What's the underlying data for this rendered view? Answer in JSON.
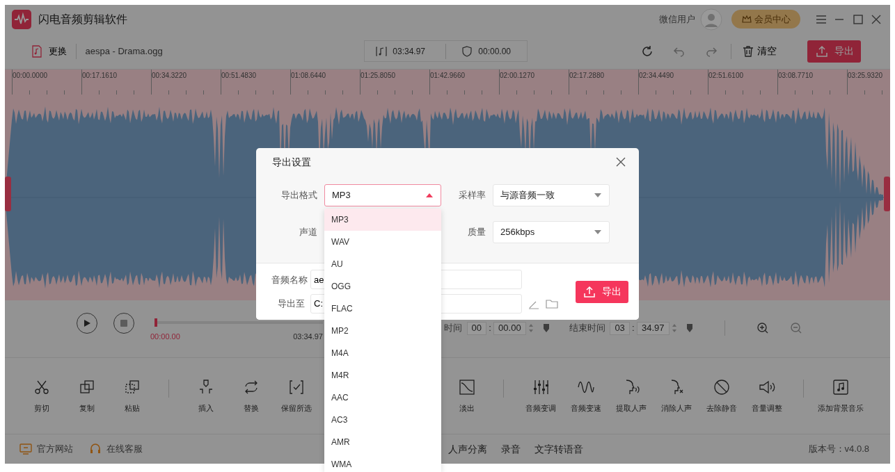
{
  "window": {
    "title": "闪电音频剪辑软件",
    "user": "微信用户",
    "member_button": "会员中心"
  },
  "toolbar": {
    "replace": "更换",
    "file_name": "aespa - Drama.ogg",
    "duration": "03:34.97",
    "selection_length": "00:00.00",
    "clear": "清空",
    "export": "导出"
  },
  "ruler": {
    "labels": [
      "00:00.0000",
      "00:17.1610",
      "00:34.3220",
      "00:51.4830",
      "01:08.6440",
      "01:25.8050",
      "01:42.9660",
      "02:00.1270",
      "02:17.2880",
      "02:34.4490",
      "02:51.6100",
      "03:08.7710",
      "03:25.9320"
    ]
  },
  "player": {
    "level": 0,
    "position": "00:00.00",
    "total": "03:34.97",
    "start_label": "时间",
    "start_minutes": "00",
    "start_separator": ":",
    "start_seconds": "00.00",
    "end_label": "结束时间",
    "end_minutes": "03",
    "end_separator": ":",
    "end_seconds": "34.97"
  },
  "tool_groups": [
    {
      "tools": [
        "剪切",
        "复制",
        "粘贴"
      ]
    },
    {
      "tools": [
        "插入",
        "替换",
        "保留所选",
        "淡出"
      ]
    },
    {
      "tools": [
        "音频变调",
        "音频变速",
        "提取人声",
        "消除人声",
        "去除静音",
        "音量调整"
      ]
    },
    {
      "tools": [
        "添加背景音乐"
      ]
    }
  ],
  "status_bar": {
    "links": [
      "官方网站",
      "在线客服"
    ],
    "tabs": [
      "人声分离",
      "录音",
      "文字转语音"
    ],
    "version": "版本号：v4.0.8"
  },
  "dialog": {
    "title": "导出设置",
    "fields": [
      {
        "label": "导出格式",
        "value": "MP3",
        "open": true
      },
      {
        "label": "采样率",
        "value": "与源音频一致",
        "open": false
      },
      {
        "label": "声道"
      },
      {
        "label": "质量",
        "value": "256kbps",
        "open": false
      }
    ],
    "name_label": "音频名称",
    "name_value": "ae",
    "path_label": "导出至",
    "path_value": "C:",
    "export": "导出"
  },
  "dropdown": {
    "options": [
      {
        "label": "MP3",
        "selected": true
      },
      {
        "label": "WAV",
        "selected": false
      },
      {
        "label": "AU",
        "selected": false
      },
      {
        "label": "OGG",
        "selected": false
      },
      {
        "label": "FLAC",
        "selected": false
      },
      {
        "label": "MP2",
        "selected": false
      },
      {
        "label": "M4A",
        "selected": false
      },
      {
        "label": "M4R",
        "selected": false
      },
      {
        "label": "AAC",
        "selected": false
      },
      {
        "label": "AC3",
        "selected": false
      },
      {
        "label": "AMR",
        "selected": false
      },
      {
        "label": "WMA",
        "selected": false
      }
    ]
  }
}
